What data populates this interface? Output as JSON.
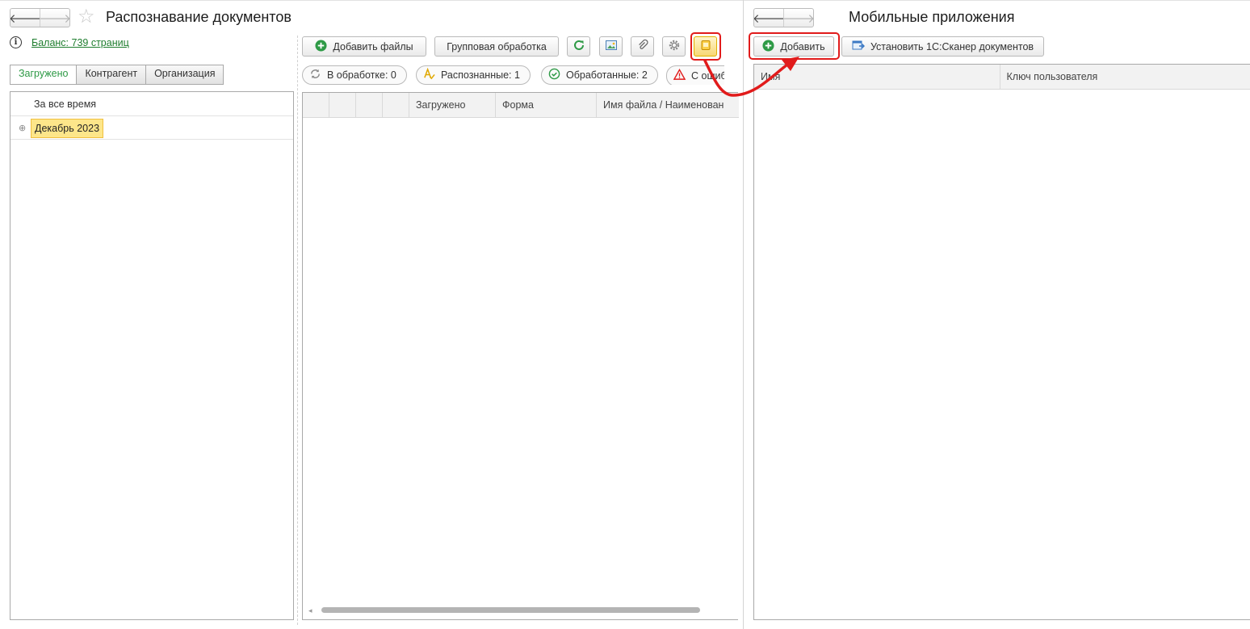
{
  "left_window": {
    "title": "Распознавание документов",
    "nav": {
      "back": "🡐",
      "forward": "🡒",
      "favorite": "☆"
    },
    "balance": {
      "info": "i",
      "link": "Баланс: 739 страниц"
    },
    "tabs": [
      "Загружено",
      "Контрагент",
      "Организация"
    ],
    "period_tree": {
      "header": "За все время",
      "items": [
        {
          "label": "Декабрь 2023",
          "expander": "⊕"
        }
      ]
    },
    "toolbar": {
      "add_files": "Добавить файлы",
      "group_processing": "Групповая обработка"
    },
    "filters": [
      {
        "label": "В обработке: 0",
        "icon": "processing-icon"
      },
      {
        "label": "Распознанные: 1",
        "icon": "recognized-icon"
      },
      {
        "label": "Обработанные: 2",
        "icon": "processed-check-icon"
      },
      {
        "label": "С ошиб",
        "icon": "warning-icon"
      }
    ],
    "table_columns": [
      "",
      "",
      "",
      "",
      "Загружено",
      "Форма",
      "Имя файла / Наименован"
    ]
  },
  "right_window": {
    "title": "Мобильные приложения",
    "nav": {
      "back": "🡐",
      "forward": "🡒"
    },
    "toolbar": {
      "add": "Добавить",
      "install": "Установить 1С:Сканер документов"
    },
    "table_columns": [
      "Имя",
      "Ключ пользователя"
    ]
  },
  "colors": {
    "accent_green": "#2e9a46",
    "highlight_red": "#e11b1b",
    "tree_selected": "#fde68a"
  }
}
